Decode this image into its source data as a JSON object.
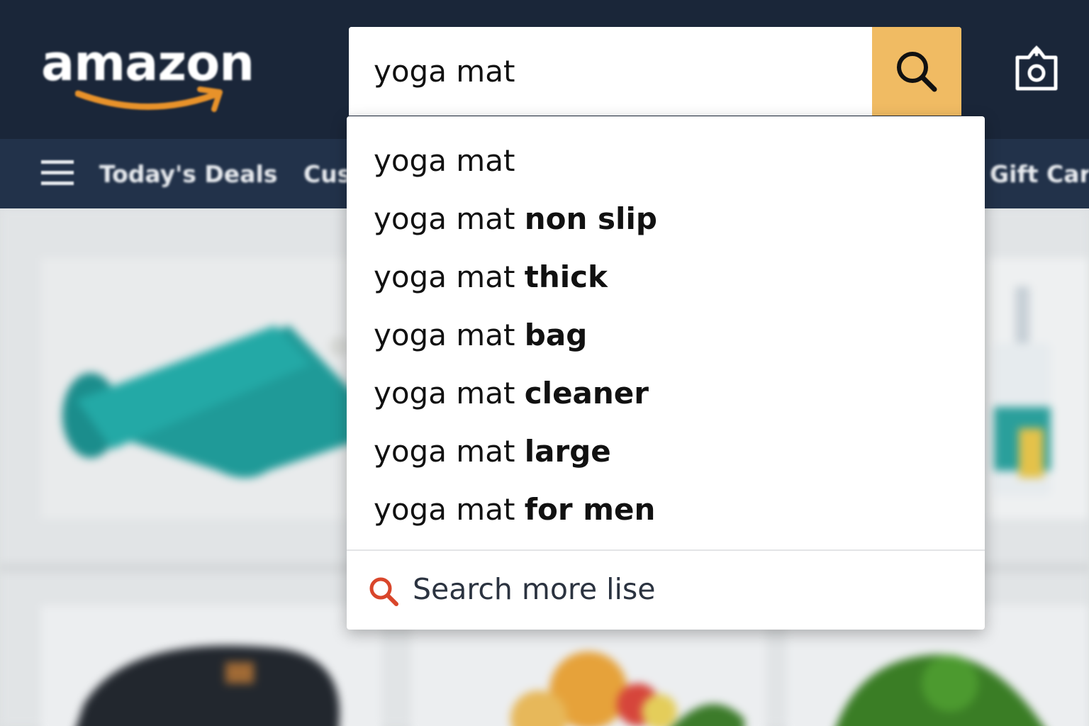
{
  "header": {
    "logo_text": "amazon",
    "search_value": "yoga mat",
    "search_icon": "search-icon",
    "camera_icon": "camera-icon",
    "brand_colors": {
      "header_bg": "#1a2639",
      "nav_bg": "#22324a",
      "search_button": "#f0bb63",
      "smile": "#e8922a"
    }
  },
  "nav": {
    "menu_icon": "hamburger-menu-icon",
    "links": [
      "Today's Deals",
      "Cus",
      "Gift Card"
    ]
  },
  "suggestions": {
    "items": [
      {
        "prefix": "yoga mat",
        "suffix": ""
      },
      {
        "prefix": "yoga mat ",
        "suffix": "non slip"
      },
      {
        "prefix": "yoga mat ",
        "suffix": "thick"
      },
      {
        "prefix": "yoga mat ",
        "suffix": "bag"
      },
      {
        "prefix": "yoga mat ",
        "suffix": "cleaner"
      },
      {
        "prefix": "yoga mat ",
        "suffix": "large"
      },
      {
        "prefix": "yoga mat ",
        "suffix": "for men"
      }
    ],
    "more_label": "Search more lise",
    "more_icon": "search-icon",
    "more_icon_color": "#d9462b"
  }
}
